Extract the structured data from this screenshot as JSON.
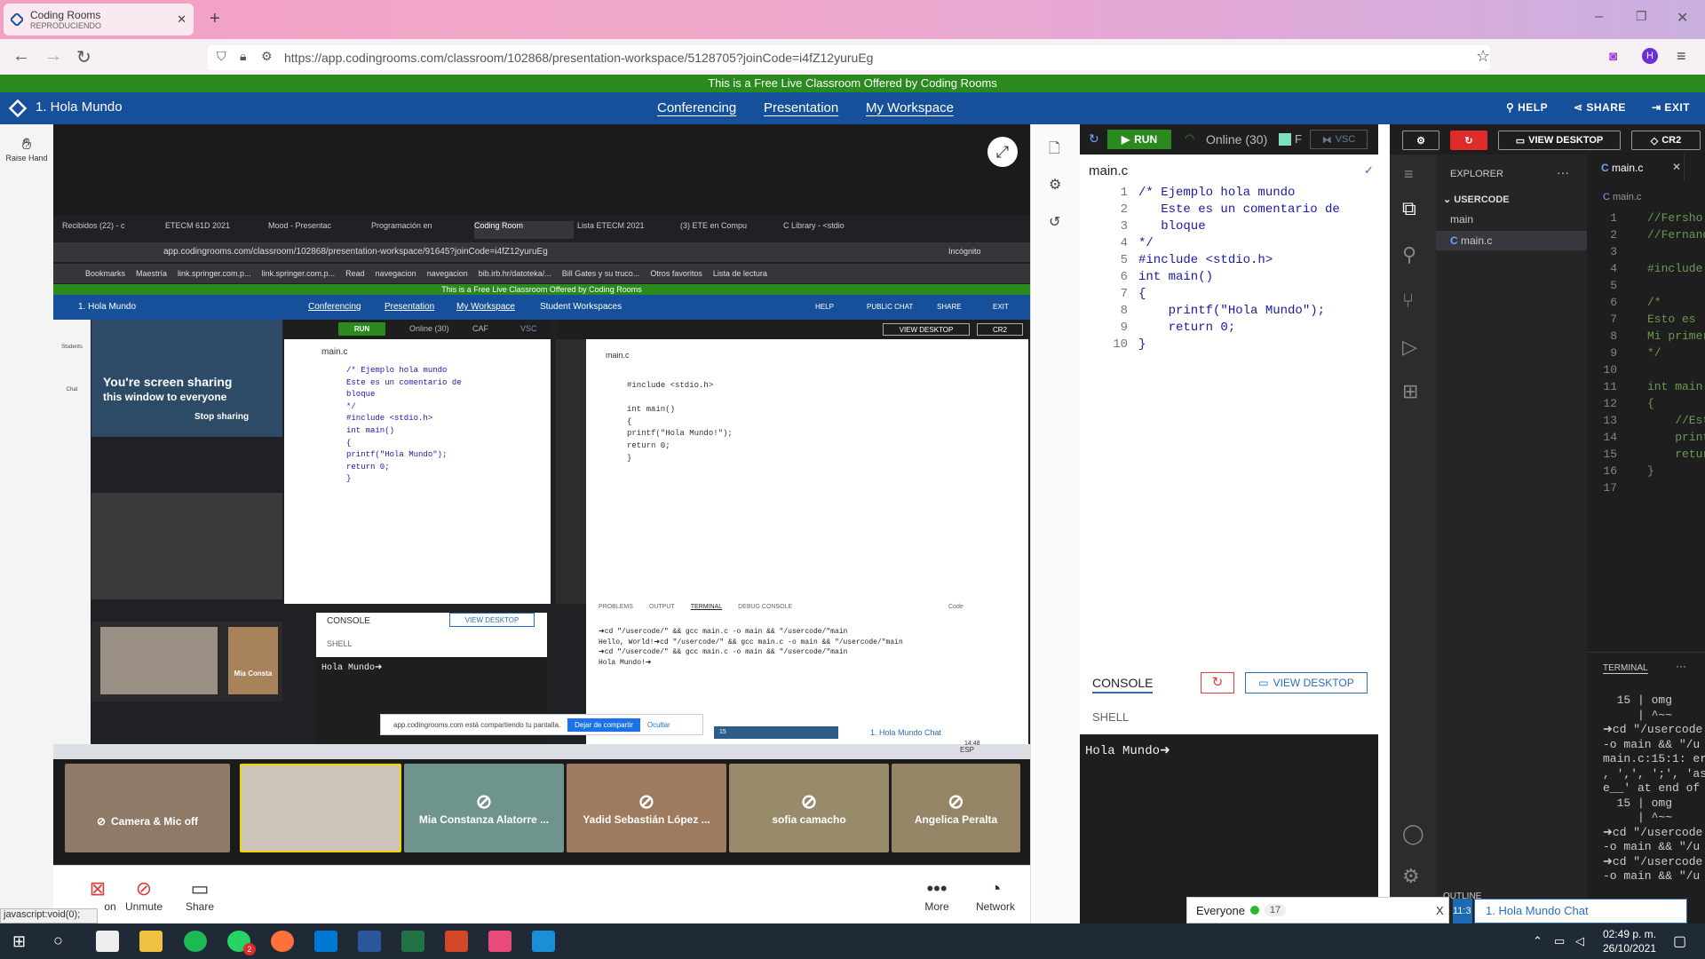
{
  "browser": {
    "tab_title": "Coding Rooms",
    "tab_subtitle": "REPRODUCIENDO",
    "url": "https://app.codingrooms.com/classroom/102868/presentation-workspace/5128705?joinCode=i4fZ12yuruEg",
    "status_url": "javascript:void(0);"
  },
  "banner": "This is a Free Live Classroom Offered by Coding Rooms",
  "app": {
    "title": "1. Hola Mundo",
    "nav": [
      "Conferencing",
      "Presentation",
      "My Workspace"
    ],
    "help": "HELP",
    "share": "SHARE",
    "exit": "EXIT",
    "raise_hand": "Raise Hand"
  },
  "shared_screen": {
    "tabs": [
      "Recibidos (22) - c",
      "ETECM 61D 2021",
      "Mood - Presentac",
      "Programación en",
      "Coding Room",
      "Lista ETECM 2021",
      "(3) ETE en Compu",
      "C Library - <stdio"
    ],
    "url": "app.codingrooms.com/classroom/102868/presentation-workspace/91645?joinCode=i4fZ12yuruEg",
    "incognito": "Incógnito",
    "bookmarks": [
      "Bookmarks",
      "Maestría",
      "link.springer.com.p...",
      "link.springer.com.p...",
      "Read",
      "navegacion",
      "navegacion",
      "bib.irb.hr/datoteka/...",
      "Bill Gates y su truco...",
      "Otros favoritos",
      "Lista de lectura"
    ],
    "banner": "This is a Free Live Classroom Offered by Coding Rooms",
    "app_title": "1. Hola Mundo",
    "nav": [
      "Conferencing",
      "Presentation",
      "My Workspace",
      "Student Workspaces"
    ],
    "right_nav": [
      "HELP",
      "PUBLIC CHAT",
      "SHARE",
      "EXIT"
    ],
    "side_labels": [
      "Students",
      "Chat"
    ],
    "sharing_title": "You're screen sharing",
    "sharing_sub": "this window to everyone",
    "stop_sharing": "Stop sharing",
    "run": "RUN",
    "online": "Online (30)",
    "caf": "CAF",
    "vsc": "VSC",
    "file_tab": "main.c",
    "view_desktop": "VIEW DESKTOP",
    "cr2": "CR2",
    "console": "CONSOLE",
    "shell": "SHELL",
    "console_out": "Hola Mundo➜",
    "camera_name": "Mia Consta",
    "code_lines": [
      "/* Ejemplo hola mundo",
      "   Este es un comentario de",
      "   bloque",
      "*/",
      "#include <stdio.h>",
      "int main()",
      "{",
      "    printf(\"Hola Mundo\");",
      "    return 0;",
      "}"
    ],
    "vs_code_lines": [
      "#include <stdio.h>",
      "",
      "int main()",
      "{",
      "    printf(\"Hola Mundo!\");",
      "    return 0;",
      "}",
      ""
    ],
    "terminal_tabs": [
      "PROBLEMS",
      "OUTPUT",
      "TERMINAL",
      "DEBUG CONSOLE"
    ],
    "terminal_code": "Code",
    "terminal_lines": [
      "➜cd \"/usercode/\" && gcc main.c -o main && \"/usercode/\"main",
      "Hello, World!➜cd \"/usercode/\" && gcc main.c -o main && \"/usercode/\"main",
      "➜cd \"/usercode/\" && gcc main.c -o main && \"/usercode/\"main",
      "Hola Mundo!➜"
    ],
    "share_notice": "app.codingrooms.com está compartiendo tu pantalla.",
    "share_stop": "Dejar de compartir",
    "share_hide": "Ocultar",
    "mini_chat": "1. Hola Mundo Chat",
    "mini_count": "15",
    "clock": "14:48",
    "lang": "ESP"
  },
  "participants": [
    {
      "name": "Camera & Mic off",
      "color": "#8f7a68"
    },
    {
      "name": "",
      "color": "#ccc4b8"
    },
    {
      "name": "Mia Constanza Alatorre ...",
      "color": "#6f948e"
    },
    {
      "name": "Yadid Sebastián López ...",
      "color": "#9e7a5e"
    },
    {
      "name": "sofia camacho",
      "color": "#978b6b"
    },
    {
      "name": "Angelica Peralta",
      "color": "#948566"
    }
  ],
  "controls": {
    "left": [
      "on",
      "Unmute",
      "Share"
    ],
    "right": [
      "More",
      "Network"
    ]
  },
  "workspace": {
    "run": "RUN",
    "online": "Online (30)",
    "f": "F",
    "vsc": "VSC",
    "file_tab": "main.c",
    "code_lines": [
      "/* Ejemplo hola mundo",
      "   Este es un comentario de",
      "   bloque",
      "*/",
      "#include <stdio.h>",
      "int main()",
      "{",
      "    printf(\"Hola Mundo\");",
      "    return 0;",
      "}"
    ],
    "line_numbers": [
      "1",
      "2",
      "3",
      "4",
      "5",
      "6",
      "7",
      "8",
      "9",
      "10"
    ],
    "console_tab": "CONSOLE",
    "view_desktop": "VIEW DESKTOP",
    "shell": "SHELL",
    "console_output": "Hola Mundo➜"
  },
  "vscode": {
    "view_desktop": "VIEW DESKTOP",
    "cr2": "CR2",
    "explorer": "EXPLORER",
    "folder": "USERCODE",
    "files": [
      "main",
      "main.c"
    ],
    "tab": "main.c",
    "breadcrumb": "main.c",
    "line_numbers": [
      "1",
      "2",
      "3",
      "4",
      "5",
      "6",
      "7",
      "8",
      "9",
      "10",
      "11",
      "12",
      "13",
      "14",
      "15",
      "16",
      "17"
    ],
    "code_lines": [
      "//Fersho",
      "//Fernand",
      "",
      "#include",
      "",
      "/*",
      "Esto es",
      "Mi primer",
      "*/",
      "",
      "int main",
      "{",
      "    //Est",
      "    print",
      "    retur",
      "}",
      ""
    ],
    "terminal": "TERMINAL",
    "terminal_lines": [
      "  15 | omg",
      "     | ^~~",
      "➜cd \"/usercode",
      "-o main && \"/u",
      "main.c:15:1: er",
      ", ',', ';', 'as",
      "e__' at end of",
      "  15 | omg",
      "     | ^~~",
      "➜cd \"/usercode",
      "-o main && \"/u",
      "➜cd \"/usercode",
      "-o main && \"/u"
    ],
    "outline": "OUTLINE"
  },
  "chat": {
    "everyone": "Everyone",
    "count": "17",
    "close": "X",
    "title": "1. Hola Mundo Chat",
    "time": "11:3"
  },
  "taskbar": {
    "time": "02:49 p. m.",
    "date": "26/10/2021",
    "whatsapp_badge": "2"
  }
}
